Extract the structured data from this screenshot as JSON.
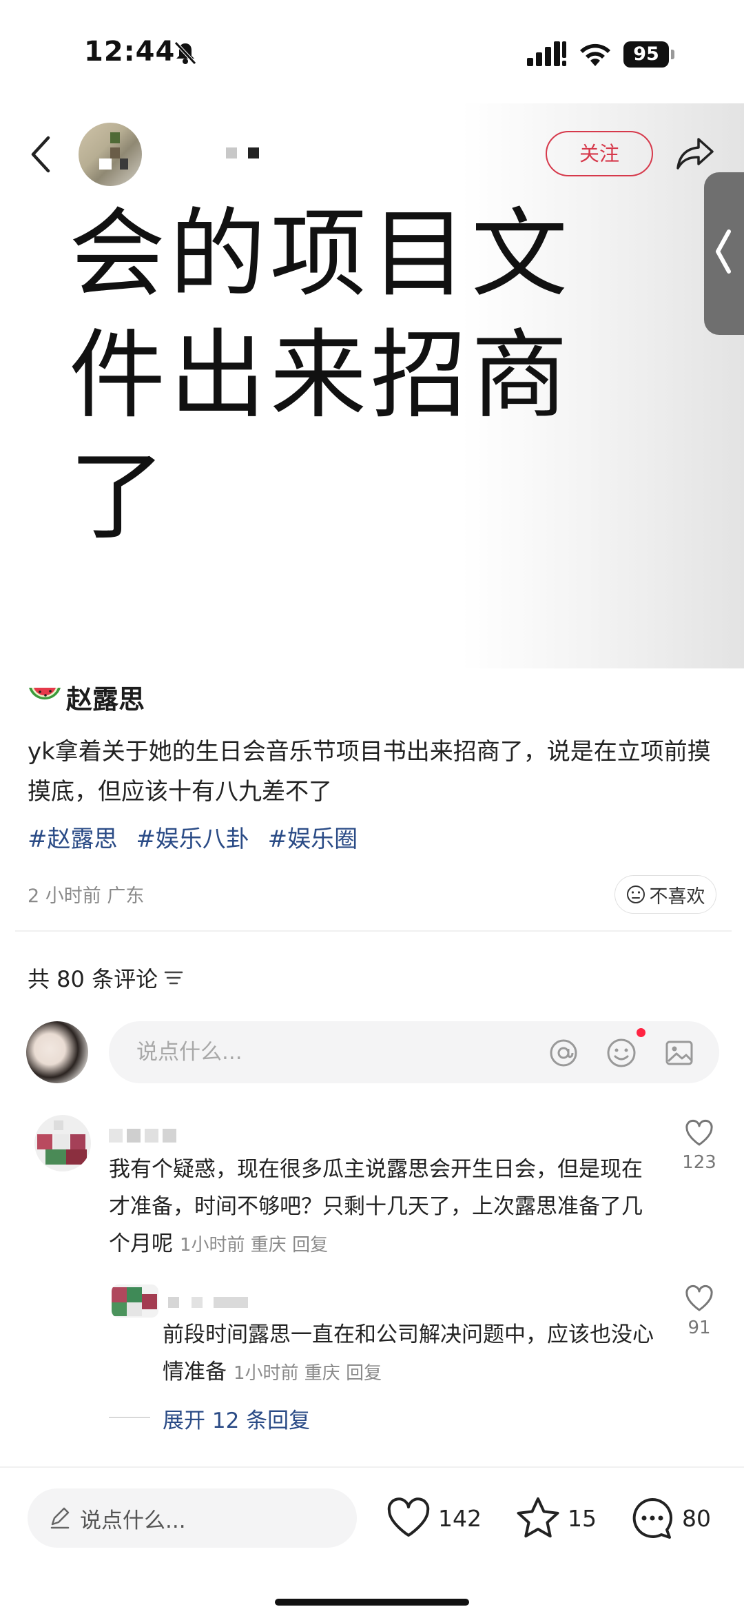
{
  "status_bar": {
    "time": "12:44",
    "battery": "95"
  },
  "header": {
    "follow_label": "关注"
  },
  "hero": {
    "lines": [
      "会的项目文",
      "件出来招商",
      "了"
    ]
  },
  "post": {
    "title": "赵露思",
    "body": "yk拿着关于她的生日会音乐节项目书出来招商了，说是在立项前摸摸底，但应该十有八九差不了",
    "tags": [
      "#赵露思",
      "#娱乐八卦",
      "#娱乐圈"
    ],
    "meta": "2 小时前 广东",
    "dislike_label": "不喜欢"
  },
  "comments_header": {
    "count_label": "共 80 条评论"
  },
  "comment_input": {
    "placeholder": "说点什么..."
  },
  "comments": [
    {
      "text": "我有个疑惑，现在很多瓜主说露思会开生日会，但是现在才准备，时间不够吧？只剩十几天了，上次露思准备了几个月呢",
      "meta": "1小时前 重庆 回复",
      "likes": "123"
    },
    {
      "text": "前段时间露思一直在和公司解决问题中，应该也没心情准备",
      "meta": "1小时前 重庆 回复",
      "likes": "91"
    }
  ],
  "expand_label": "展开 12 条回复",
  "bottom_bar": {
    "input_label": "说点什么...",
    "likes": "142",
    "stars": "15",
    "comments": "80"
  },
  "colors": {
    "accent": "#d6394b",
    "link": "#2a4b86",
    "like_dot": "#ff2442"
  },
  "icons": [
    "bell-muted-icon",
    "signal-icon",
    "wifi-icon",
    "back-icon",
    "share-icon",
    "collapse-tab-icon",
    "watermelon-icon",
    "dislike-face-icon",
    "sort-icon",
    "at-icon",
    "emoji-icon",
    "image-icon",
    "heart-icon",
    "pencil-icon",
    "star-icon",
    "comment-icon"
  ]
}
